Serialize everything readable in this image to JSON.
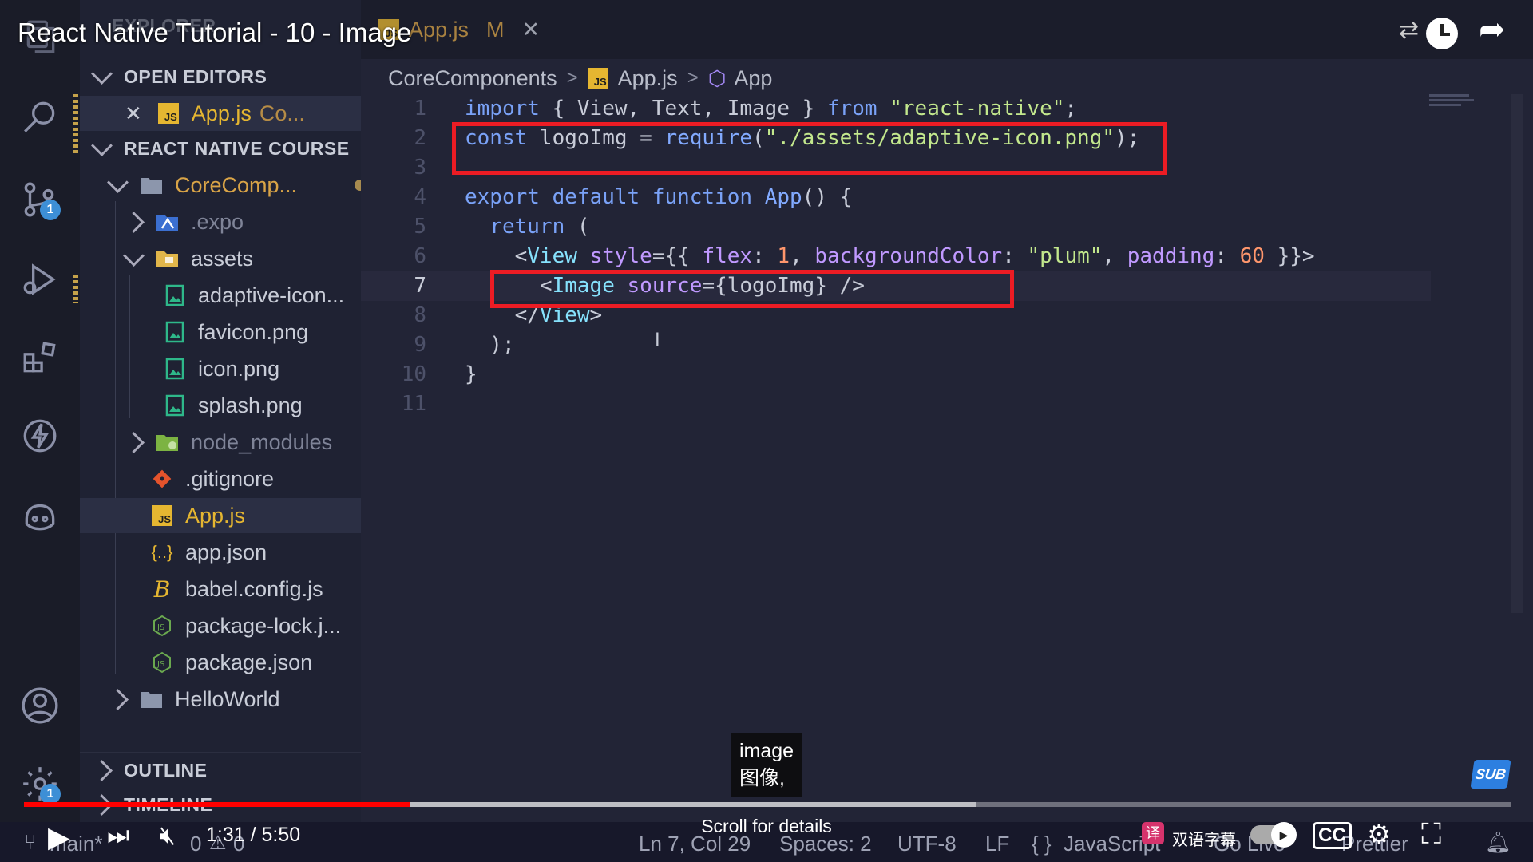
{
  "video": {
    "title": "React Native Tutorial - 10 - Image",
    "time": "1:31 / 5:50",
    "caption_en": "image",
    "caption_zh": "图像,",
    "scroll_hint": "Scroll for details",
    "bilingual_label": "双语字幕",
    "sub_badge": "SUB",
    "progress_played": 0.26,
    "progress_buffered": 0.64
  },
  "sidebar": {
    "explorer_label": "EXPLORER",
    "open_editors_label": "OPEN EDITORS",
    "open_editor_file": "App.js",
    "open_editor_path": "Co...",
    "modified_flag": "M",
    "project_label": "REACT NATIVE COURSE",
    "tree": [
      {
        "name": "CoreComp...",
        "kind": "folder-open",
        "depth": 1
      },
      {
        "name": ".expo",
        "kind": "folder",
        "depth": 2
      },
      {
        "name": "assets",
        "kind": "folder-open",
        "depth": 2
      },
      {
        "name": "adaptive-icon...",
        "kind": "image",
        "depth": 3
      },
      {
        "name": "favicon.png",
        "kind": "image",
        "depth": 3
      },
      {
        "name": "icon.png",
        "kind": "image",
        "depth": 3
      },
      {
        "name": "splash.png",
        "kind": "image",
        "depth": 3
      },
      {
        "name": "node_modules",
        "kind": "folder",
        "depth": 2
      },
      {
        "name": ".gitignore",
        "kind": "git",
        "depth": 2
      },
      {
        "name": "App.js",
        "kind": "js",
        "depth": 2
      },
      {
        "name": "app.json",
        "kind": "json",
        "depth": 2
      },
      {
        "name": "babel.config.js",
        "kind": "babel",
        "depth": 2
      },
      {
        "name": "package-lock.j...",
        "kind": "node",
        "depth": 2
      },
      {
        "name": "package.json",
        "kind": "node",
        "depth": 2
      },
      {
        "name": "HelloWorld",
        "kind": "folder",
        "depth": 1
      }
    ],
    "outline_label": "OUTLINE",
    "timeline_label": "TIMELINE"
  },
  "activity": {
    "scm_badge": "1",
    "settings_badge": "1"
  },
  "tab": {
    "label": "App.js",
    "flag": "M",
    "close": "✕"
  },
  "breadcrumb": {
    "folder": "CoreComponents",
    "file": "App.js",
    "symbol": "App"
  },
  "code_lines": [
    {
      "n": "1",
      "text": "import { View, Text, Image } from \"react-native\";"
    },
    {
      "n": "2",
      "text": "const logoImg = require(\"./assets/adaptive-icon.png\");"
    },
    {
      "n": "3",
      "text": ""
    },
    {
      "n": "4",
      "text": "export default function App() {"
    },
    {
      "n": "5",
      "text": "  return ("
    },
    {
      "n": "6",
      "text": "    <View style={{ flex: 1, backgroundColor: \"plum\", padding: 60 }}>"
    },
    {
      "n": "7",
      "text": "      <Image source={logoImg} />"
    },
    {
      "n": "8",
      "text": "    </View>"
    },
    {
      "n": "9",
      "text": "  );"
    },
    {
      "n": "10",
      "text": "}"
    },
    {
      "n": "11",
      "text": ""
    }
  ],
  "status": {
    "branch": "main*",
    "errors": "0",
    "warnings": "0",
    "position": "Ln 7, Col 29",
    "spaces": "Spaces: 2",
    "encoding": "UTF-8",
    "eol": "LF",
    "language": "JavaScript",
    "golive": "Go Live",
    "prettier": "Prettier"
  },
  "colors": {
    "highlight_box": "#ec1c24",
    "progress": "#ff0000",
    "modified": "#d9b35c"
  }
}
